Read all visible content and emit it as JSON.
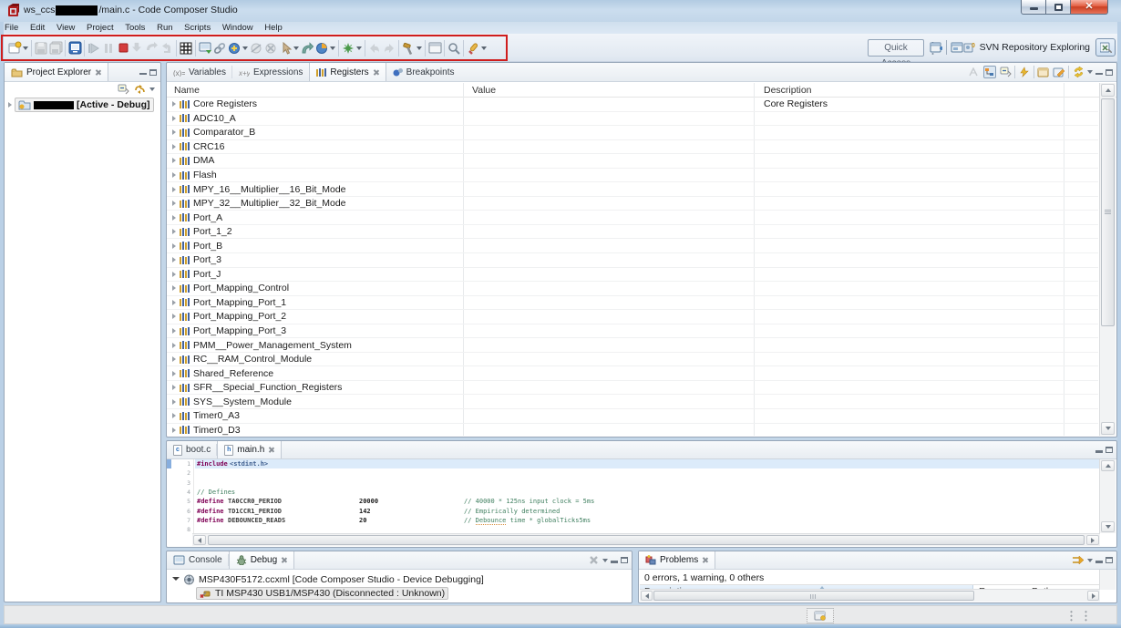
{
  "window": {
    "title_prefix": "ws_ccs",
    "title_suffix": "/main.c - Code Composer Studio"
  },
  "menu": {
    "items": [
      "File",
      "Edit",
      "View",
      "Project",
      "Tools",
      "Run",
      "Scripts",
      "Window",
      "Help"
    ]
  },
  "toolbar": {
    "quick_access": "Quick Access",
    "perspective_label": "SVN Repository Exploring"
  },
  "project_explorer": {
    "title": "Project Explorer",
    "item_label": "[Active - Debug]"
  },
  "debug_view": {
    "tabs": {
      "variables": "Variables",
      "expressions": "Expressions",
      "registers": "Registers",
      "breakpoints": "Breakpoints"
    },
    "columns": {
      "name": "Name",
      "value": "Value",
      "description": "Description"
    },
    "rows": [
      {
        "name": "Core Registers",
        "value": "",
        "description": "Core Registers"
      },
      {
        "name": "ADC10_A",
        "value": "",
        "description": ""
      },
      {
        "name": "Comparator_B",
        "value": "",
        "description": ""
      },
      {
        "name": "CRC16",
        "value": "",
        "description": ""
      },
      {
        "name": "DMA",
        "value": "",
        "description": ""
      },
      {
        "name": "Flash",
        "value": "",
        "description": ""
      },
      {
        "name": "MPY_16__Multiplier__16_Bit_Mode",
        "value": "",
        "description": ""
      },
      {
        "name": "MPY_32__Multiplier__32_Bit_Mode",
        "value": "",
        "description": ""
      },
      {
        "name": "Port_A",
        "value": "",
        "description": ""
      },
      {
        "name": "Port_1_2",
        "value": "",
        "description": ""
      },
      {
        "name": "Port_B",
        "value": "",
        "description": ""
      },
      {
        "name": "Port_3",
        "value": "",
        "description": ""
      },
      {
        "name": "Port_J",
        "value": "",
        "description": ""
      },
      {
        "name": "Port_Mapping_Control",
        "value": "",
        "description": ""
      },
      {
        "name": "Port_Mapping_Port_1",
        "value": "",
        "description": ""
      },
      {
        "name": "Port_Mapping_Port_2",
        "value": "",
        "description": ""
      },
      {
        "name": "Port_Mapping_Port_3",
        "value": "",
        "description": ""
      },
      {
        "name": "PMM__Power_Management_System",
        "value": "",
        "description": ""
      },
      {
        "name": "RC__RAM_Control_Module",
        "value": "",
        "description": ""
      },
      {
        "name": "Shared_Reference",
        "value": "",
        "description": ""
      },
      {
        "name": "SFR__Special_Function_Registers",
        "value": "",
        "description": ""
      },
      {
        "name": "SYS__System_Module",
        "value": "",
        "description": ""
      },
      {
        "name": "Timer0_A3",
        "value": "",
        "description": ""
      },
      {
        "name": "Timer0_D3",
        "value": "",
        "description": ""
      }
    ]
  },
  "editor": {
    "tabs": {
      "boot": "boot.c",
      "main": "main.h"
    },
    "lines": {
      "l1_num": "1",
      "l1_directive": "#include",
      "l1_include": "<stdint.h>",
      "l2_num": "2",
      "l3_num": "3",
      "l4_num": "4",
      "l4_comment": "// Defines",
      "l5_num": "5",
      "l5_directive": "#define",
      "l5_name": "TA0CCR0_PERIOD",
      "l5_value": "20000",
      "l5_comment": "// 40000 * 125ns input clock = 5ms",
      "l6_num": "6",
      "l6_directive": "#define",
      "l6_name": "TD1CCR1_PERIOD",
      "l6_value": "142",
      "l6_comment": "// Empirically determined",
      "l7_num": "7",
      "l7_directive": "#define",
      "l7_name": "DEBOUNCED_READS",
      "l7_value": "20",
      "l7_comment_pre": "// ",
      "l7_comment_word": "Debounce",
      "l7_comment_post": " time * globalTicks5ms",
      "l8_num": "8"
    }
  },
  "console": {
    "tabs": {
      "console": "Console",
      "debug": "Debug"
    },
    "tree": {
      "row1": "MSP430F5172.ccxml [Code Composer Studio - Device Debugging]",
      "row2": "TI MSP430 USB1/MSP430 (Disconnected : Unknown)"
    }
  },
  "problems": {
    "tab": "Problems",
    "summary": "0 errors, 1 warning, 0 others",
    "columns": {
      "description": "Description",
      "resource": "Resource",
      "path": "Path"
    }
  }
}
